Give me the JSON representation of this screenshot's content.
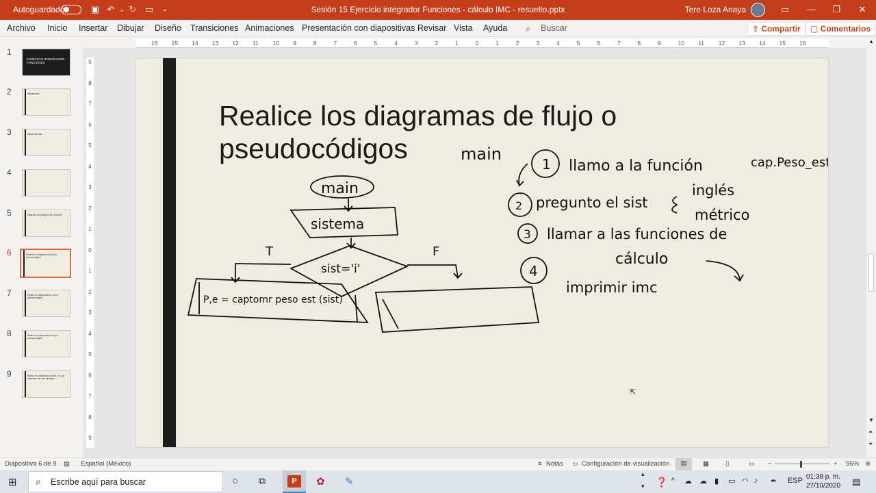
{
  "titlebar": {
    "autosave_label": "Autoguardado",
    "document_title": "Sesión 15 Ejercicio integrador Funciones - cálculo IMC - resuelto.pptx",
    "user_name": "Tere Loza Anaya"
  },
  "ribbon": {
    "tabs": [
      "Archivo",
      "Inicio",
      "Insertar",
      "Dibujar",
      "Diseño",
      "Transiciones",
      "Animaciones",
      "Presentación con diapositivas",
      "Revisar",
      "Vista",
      "Ayuda"
    ],
    "search_label": "Buscar",
    "share_label": "Compartir",
    "comments_label": "Comentarios"
  },
  "thumbnails": [
    {
      "num": "1",
      "text": "EJERCICIO INTEGRADOR FUNCIONES"
    },
    {
      "num": "2",
      "text": "Indicaciones"
    },
    {
      "num": "3",
      "text": "Cálculo de IMC"
    },
    {
      "num": "4",
      "text": ""
    },
    {
      "num": "5",
      "text": "Diagrama de jerarquía de funciones"
    },
    {
      "num": "6",
      "text": "Realice los diagramas de flujo o pseudocódigos"
    },
    {
      "num": "7",
      "text": "Realice los diagramas de flujo o pseudocódigos"
    },
    {
      "num": "8",
      "text": "Realice los diagramas de flujo o pseudocódigos"
    },
    {
      "num": "9",
      "text": "Realice la codificación acorde a lo que expresión con tres ejemplos"
    }
  ],
  "ruler": {
    "h_ticks": [
      "16",
      "15",
      "14",
      "13",
      "12",
      "11",
      "10",
      "9",
      "8",
      "7",
      "6",
      "5",
      "4",
      "3",
      "2",
      "1",
      "0",
      "1",
      "2",
      "3",
      "4",
      "5",
      "6",
      "7",
      "8",
      "9",
      "10",
      "11",
      "12",
      "13",
      "14",
      "15",
      "16"
    ],
    "v_ticks": [
      "9",
      "8",
      "7",
      "6",
      "5",
      "4",
      "3",
      "2",
      "1",
      "0",
      "1",
      "2",
      "3",
      "4",
      "5",
      "6",
      "7",
      "8",
      "9"
    ]
  },
  "slide": {
    "title": "Realice los diagramas de flujo o pseudocódigos",
    "ink": {
      "main_left": "main",
      "main_top": "main",
      "step1": "llamo a la función",
      "cap": "cap.Peso_est.",
      "step2": "pregunto el sist",
      "ingles": "inglés",
      "metrico": "métrico",
      "step3": "llamar a las funciones de",
      "calculo": "cálculo",
      "imprimir": "imprimir imc",
      "n1": "1",
      "n2": "2",
      "n3": "3",
      "n4": "4",
      "sistema": "sistema",
      "decision": "sist='i'",
      "T": "T",
      "F": "F",
      "captura": "P,e = captomr peso est (sist)"
    }
  },
  "status": {
    "slide_counter": "Diapositiva 6 de 9",
    "language": "Español (México)",
    "notes": "Notas",
    "view_config": "Configuración de visualización",
    "zoom": "95%"
  },
  "taskbar": {
    "search_placeholder": "Escribe aquí para buscar",
    "lang": "ESP",
    "time": "01:38 p. m.",
    "date": "27/10/2020"
  },
  "colors": {
    "accent": "#c43e1c",
    "slide_bg": "#efece1",
    "stripe": "#1c1c1c"
  }
}
